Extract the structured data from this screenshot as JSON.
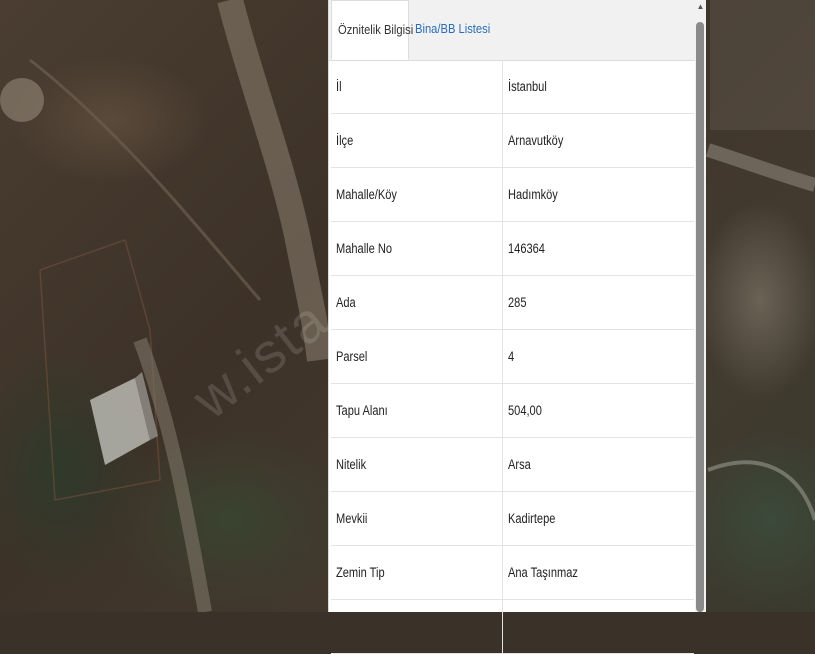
{
  "tabs": [
    {
      "label": "Öznitelik Bilgisi",
      "active": true
    },
    {
      "label": "Bina/BB Listesi",
      "active": false
    }
  ],
  "attributes": [
    {
      "key": "İl",
      "value": "İstanbul"
    },
    {
      "key": "İlçe",
      "value": "Arnavutköy"
    },
    {
      "key": "Mahalle/Köy",
      "value": "Hadımköy"
    },
    {
      "key": "Mahalle No",
      "value": "146364"
    },
    {
      "key": "Ada",
      "value": "285"
    },
    {
      "key": "Parsel",
      "value": "4"
    },
    {
      "key": "Tapu Alanı",
      "value": "504,00"
    },
    {
      "key": "Nitelik",
      "value": "Arsa"
    },
    {
      "key": "Mevkii",
      "value": "Kadirtepe"
    },
    {
      "key": "Zemin Tip",
      "value": "Ana Taşınmaz"
    },
    {
      "key": "",
      "value": ""
    }
  ],
  "map": {
    "watermark": "w.ista"
  },
  "colors": {
    "link": "#2a6db5",
    "panel_bg": "#ffffff",
    "tab_bg": "#f1f1f1"
  },
  "icons": {
    "scroll_up": "triangle-up-icon"
  }
}
